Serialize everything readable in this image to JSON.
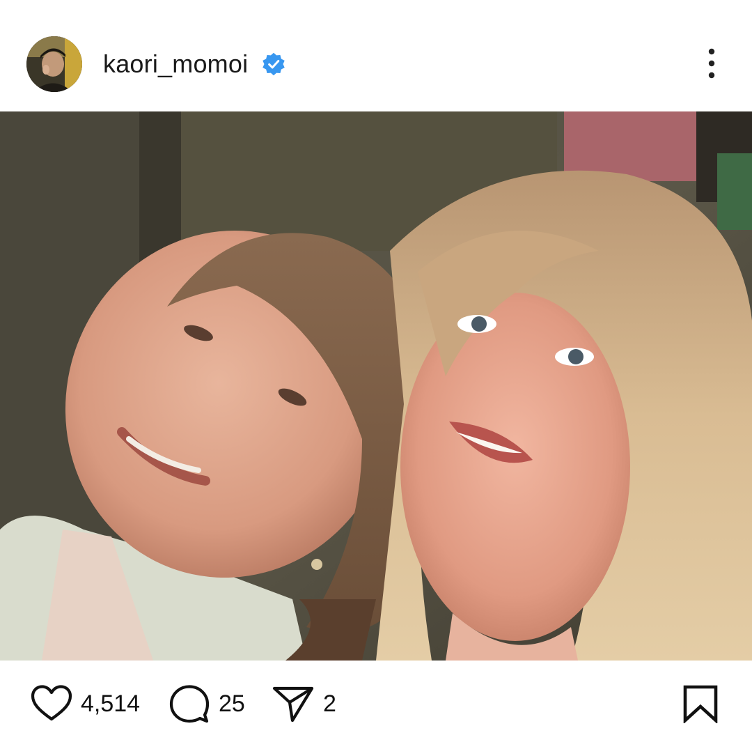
{
  "header": {
    "username": "kaori_momoi",
    "verified": true,
    "avatar_icon": "profile-avatar",
    "more_icon": "more-vertical-icon"
  },
  "post": {
    "image_description_icon": "selfie-photo"
  },
  "actions": {
    "likes": "4,514",
    "comments": "25",
    "shares": "2",
    "like_icon": "heart-icon",
    "comment_icon": "comment-icon",
    "share_icon": "send-icon",
    "save_icon": "bookmark-icon"
  },
  "colors": {
    "verified_badge": "#3897f0",
    "icon_stroke": "#111111",
    "background": "#ffffff"
  }
}
